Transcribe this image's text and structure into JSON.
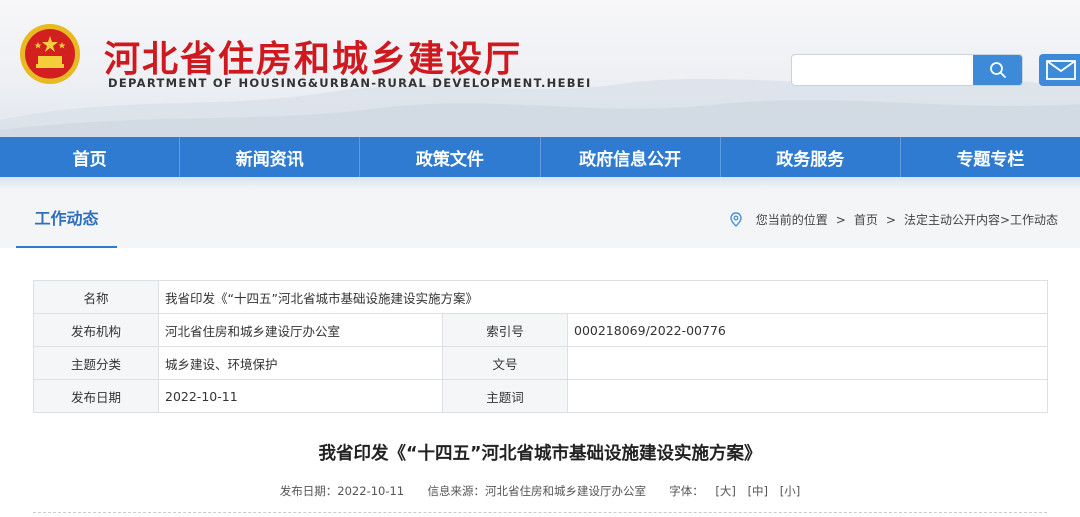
{
  "header": {
    "title": "河北省住房和城乡建设厅",
    "subtitle": "DEPARTMENT OF HOUSING&URBAN-RURAL DEVELOPMENT.HEBEI",
    "search": {
      "value": "",
      "placeholder": ""
    },
    "icons": {
      "emblem": "national-emblem",
      "search": "search-icon",
      "mail": "mail-icon"
    },
    "colors": {
      "title": "#d0181f",
      "nav": "#2f7bd1"
    }
  },
  "nav": {
    "items": [
      "首页",
      "新闻资讯",
      "政策文件",
      "政府信息公开",
      "政务服务",
      "专题专栏"
    ]
  },
  "section": {
    "title": "工作动态"
  },
  "breadcrumb": {
    "prefix": "您当前的位置",
    "home": "首页",
    "path": "法定主动公开内容>工作动态"
  },
  "info": {
    "name_label": "名称",
    "name_value": "我省印发《“十四五”河北省城市基础设施建设实施方案》",
    "publisher_label": "发布机构",
    "publisher_value": "河北省住房和城乡建设厅办公室",
    "index_label": "索引号",
    "index_value": "000218069/2022-00776",
    "category_label": "主题分类",
    "category_value": "城乡建设、环境保护",
    "docno_label": "文号",
    "docno_value": "",
    "date_label": "发布日期",
    "date_value": "2022-10-11",
    "keywords_label": "主题词",
    "keywords_value": ""
  },
  "article": {
    "title": "我省印发《“十四五”河北省城市基础设施建设实施方案》",
    "meta_date": "发布日期：2022-10-11",
    "meta_source": "信息来源：河北省住房和城乡建设厅办公室",
    "font_label": "字体：",
    "font_large": "[大]",
    "font_medium": "[中]",
    "font_small": "[小]"
  }
}
